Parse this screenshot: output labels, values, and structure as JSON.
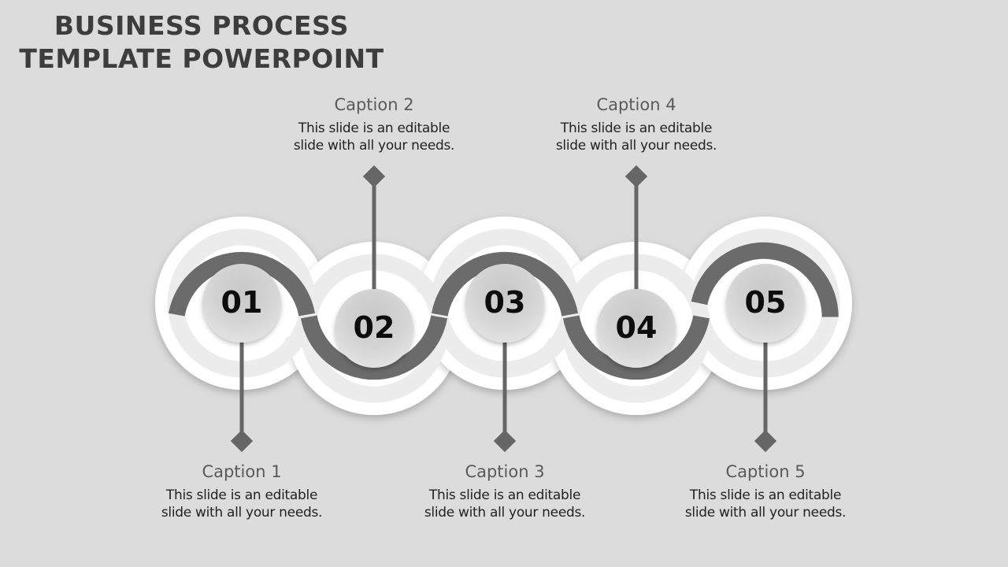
{
  "title": {
    "line1": "BUSINESS PROCESS",
    "line2": "TEMPLATE POWERPOINT"
  },
  "colors": {
    "background": "#dcdcdc",
    "band": "#6b6b6b",
    "ring": "#ffffff",
    "badge": "#cfcfcf",
    "connector": "#666666",
    "title": "#3d3d3d",
    "caption_heading": "#5a5a5a",
    "caption_body": "#222222"
  },
  "steps": [
    {
      "number": "01",
      "caption": "Caption 1",
      "text_line1": "This slide is an editable",
      "text_line2": "slide with all your needs.",
      "label_side": "bottom"
    },
    {
      "number": "02",
      "caption": "Caption 2",
      "text_line1": "This slide is an editable",
      "text_line2": "slide with all your needs.",
      "label_side": "top"
    },
    {
      "number": "03",
      "caption": "Caption 3",
      "text_line1": "This slide is an editable",
      "text_line2": "slide with all your needs.",
      "label_side": "bottom"
    },
    {
      "number": "04",
      "caption": "Caption 4",
      "text_line1": "This slide is an editable",
      "text_line2": "slide with all your needs.",
      "label_side": "top"
    },
    {
      "number": "05",
      "caption": "Caption 5",
      "text_line1": "This slide is an editable",
      "text_line2": "slide with all your needs.",
      "label_side": "bottom"
    }
  ]
}
